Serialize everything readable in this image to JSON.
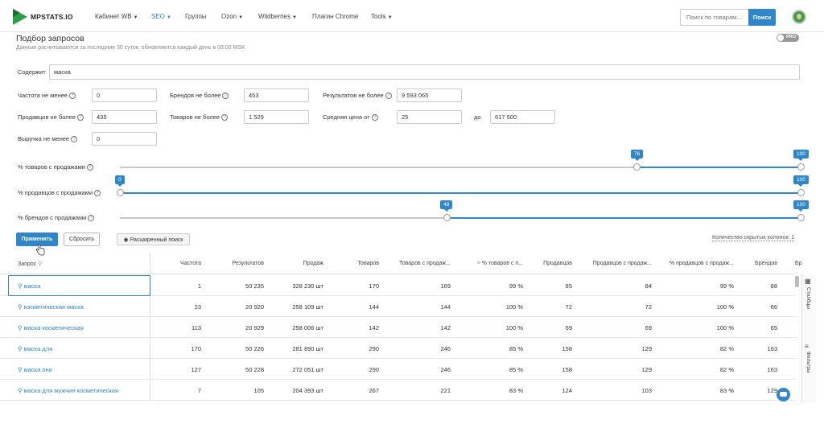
{
  "nav": {
    "logo": "MPSTATS.IO",
    "items": [
      {
        "label": "Кабинет WB",
        "caret": true,
        "active": false
      },
      {
        "label": "SEO",
        "caret": true,
        "active": true
      },
      {
        "label": "Группы",
        "caret": false,
        "active": false
      },
      {
        "label": "Ozon",
        "caret": true,
        "active": false
      },
      {
        "label": "Wildberries",
        "caret": true,
        "active": false
      },
      {
        "label": "Плагин Chrome",
        "caret": false,
        "active": false
      },
      {
        "label": "Tools",
        "caret": true,
        "active": false
      }
    ],
    "search_placeholder": "Поиск по товарам...",
    "search_button": "Поиск"
  },
  "page": {
    "title": "Подбор запросов",
    "subtitle": "Данные расчитываются за последние 30 суток, обновляются каждый день в 03:00 MSK",
    "toggle_label": "PRO"
  },
  "filters": {
    "contains_label": "Содержит",
    "contains_value": "маска",
    "freq_min_label": "Частота не менее",
    "freq_min_value": "0",
    "brands_max_label": "Брендов не более",
    "brands_max_value": "453",
    "results_max_label": "Результатов не более",
    "results_max_value": "9 593 065",
    "sellers_max_label": "Продавцов не более",
    "sellers_max_value": "435",
    "goods_max_label": "Товаров не более",
    "goods_max_value": "1 529",
    "avg_price_label": "Средняя цена от",
    "avg_price_from": "25",
    "avg_price_to_label": "до",
    "avg_price_to": "617 500",
    "revenue_min_label": "Выручка не менее",
    "revenue_min_value": "0"
  },
  "sliders": [
    {
      "label": "% товаров с продажами",
      "min": 76,
      "max": 100,
      "min_label": "76",
      "max_label": "100"
    },
    {
      "label": "% продавцов с продажами",
      "min": 0,
      "max": 100,
      "min_label": "0",
      "max_label": "100"
    },
    {
      "label": "% брендов с продажами",
      "min": 48,
      "max": 100,
      "min_label": "48",
      "max_label": "100"
    }
  ],
  "actions": {
    "apply": "Применить",
    "reset": "Сбросить",
    "advanced": "Расширенный поиск",
    "hidden_cols_label": "Количество скрытых колонок:",
    "hidden_cols_count": "1"
  },
  "table": {
    "headers": [
      "Запрос",
      "Частота",
      "Результатов",
      "Продаж",
      "Товаров",
      "Товаров с продаж...",
      "% товаров с п...",
      "Продавцов",
      "Продавцов с продаж...",
      "% продавцов с продаж...",
      "Брендов",
      "Бр"
    ],
    "rows": [
      [
        "маска",
        "1",
        "50 235",
        "328 230 шт",
        "170",
        "169",
        "99 %",
        "85",
        "84",
        "99 %",
        "88"
      ],
      [
        "косметическая маска",
        "23",
        "20 920",
        "258 109 шт",
        "144",
        "144",
        "100 %",
        "72",
        "72",
        "100 %",
        "66"
      ],
      [
        "маска косметическая",
        "113",
        "20 929",
        "258 006 шт",
        "142",
        "142",
        "100 %",
        "69",
        "69",
        "100 %",
        "65"
      ],
      [
        "маска для",
        "170",
        "50 226",
        "281 890 шт",
        "290",
        "246",
        "85 %",
        "158",
        "129",
        "82 %",
        "163"
      ],
      [
        "маска они",
        "127",
        "50 228",
        "272 051 шт",
        "290",
        "246",
        "85 %",
        "158",
        "129",
        "82 %",
        "163"
      ],
      [
        "маска для мужчин косметическая",
        "7",
        "105",
        "204 393 шт",
        "267",
        "221",
        "83 %",
        "124",
        "103",
        "83 %",
        "129"
      ]
    ]
  },
  "sidebar": {
    "columns": "Столбцы",
    "filters": "Фильтры"
  }
}
